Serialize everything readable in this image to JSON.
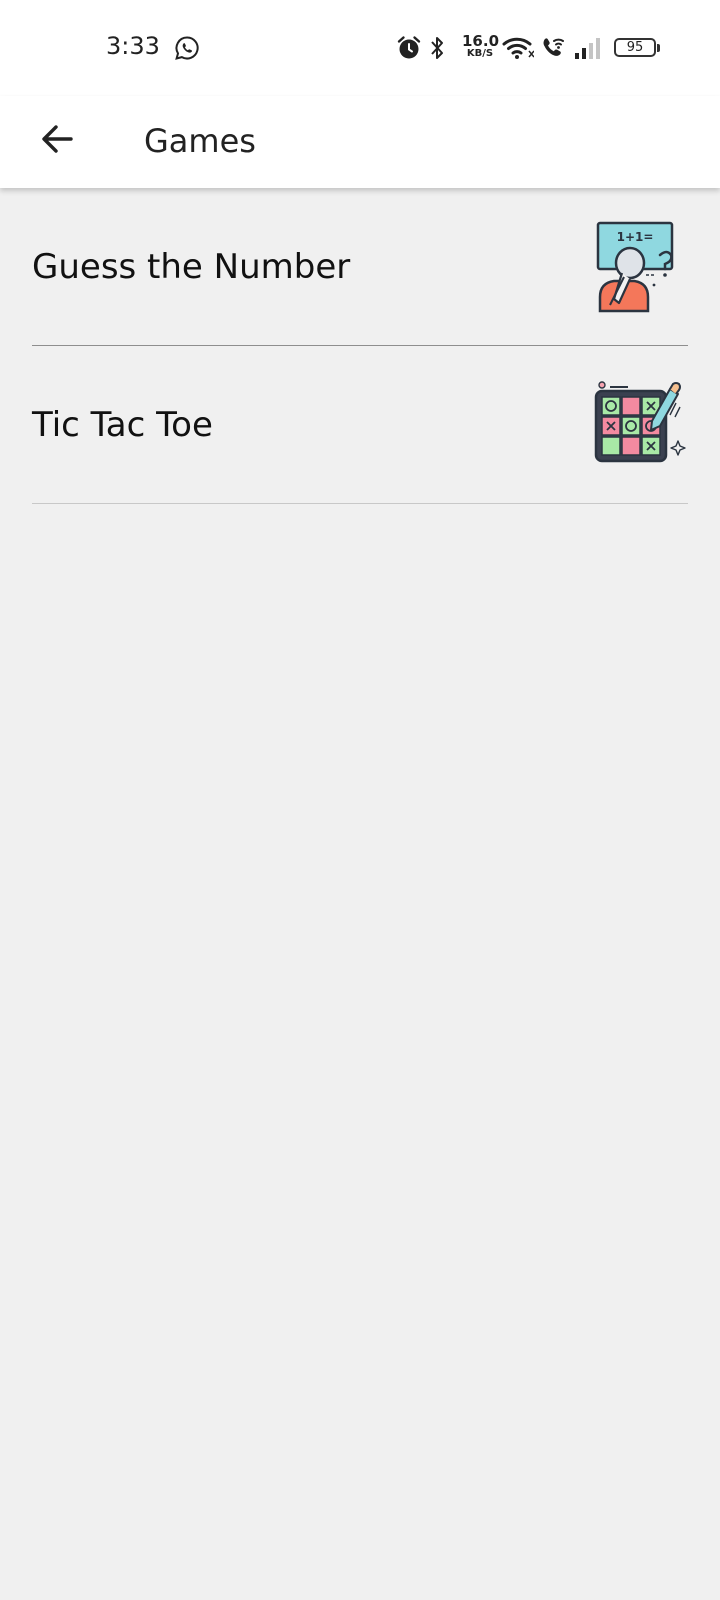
{
  "status_bar": {
    "time": "3:33",
    "net_speed_value": "16.0",
    "net_speed_unit": "KB/S",
    "battery": "95",
    "icons": [
      "whatsapp-icon",
      "alarm-icon",
      "bluetooth-icon",
      "wifi-icon",
      "wifi-calling-icon",
      "signal-icon",
      "battery-icon"
    ]
  },
  "app_bar": {
    "back_icon": "arrow-left-icon",
    "title": "Games"
  },
  "games": [
    {
      "label": "Guess the Number",
      "icon": "guess-number-icon",
      "board_text": "1+1="
    },
    {
      "label": "Tic Tac Toe",
      "icon": "tic-tac-toe-icon"
    }
  ],
  "colors": {
    "background": "#f0f0f0",
    "app_bar": "#ffffff",
    "text": "#222222",
    "divider": "#8e8e8e"
  }
}
